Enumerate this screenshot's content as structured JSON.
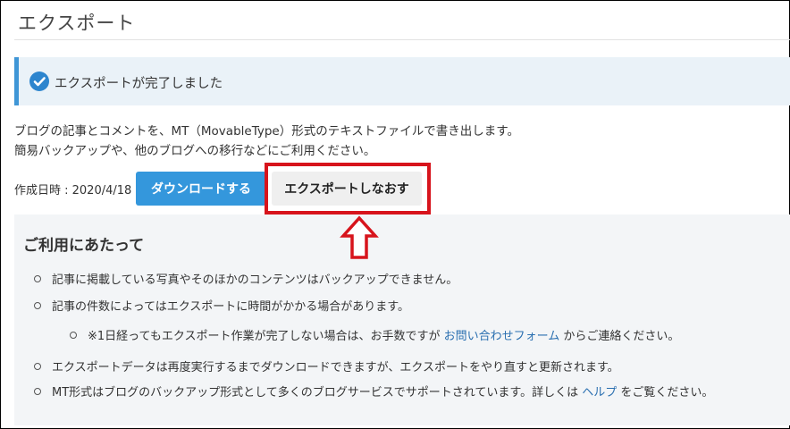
{
  "header": {
    "title": "エクスポート"
  },
  "alert": {
    "icon": "check-circle-icon",
    "message": "エクスポートが完了しました"
  },
  "description": {
    "line1": "ブログの記事とコメントを、MT（MovableType）形式のテキストファイルで書き出します。",
    "line2": "簡易バックアップや、他のブログへの移行などにご利用ください。"
  },
  "export_actions": {
    "created_label": "作成日時 : 2020/4/18",
    "download_label": "ダウンロードする",
    "reexport_label": "エクスポートしなおす"
  },
  "notes": {
    "title": "ご利用にあたって",
    "item1": "記事に掲載している写真やそのほかのコンテンツはバックアップできません。",
    "item2": "記事の件数によってはエクスポートに時間がかかる場合があります。",
    "sub_prefix": "※1日経ってもエクスポート作業が完了しない場合は、お手数ですが ",
    "sub_link": "お問い合わせフォーム",
    "sub_suffix": " からご連絡ください。",
    "item3": "エクスポートデータは再度実行するまでダウンロードできますが、エクスポートをやり直すと更新されます。",
    "item4_prefix": "MT形式はブログのバックアップ形式として多くのブログサービスでサポートされています。詳しくは ",
    "item4_link": "ヘルプ",
    "item4_suffix": " をご覧ください。"
  },
  "colors": {
    "accent": "#3497dc",
    "highlight": "#d7141c",
    "alert_bg": "#eaf2f8",
    "notes_bg": "#f3f5f7"
  }
}
